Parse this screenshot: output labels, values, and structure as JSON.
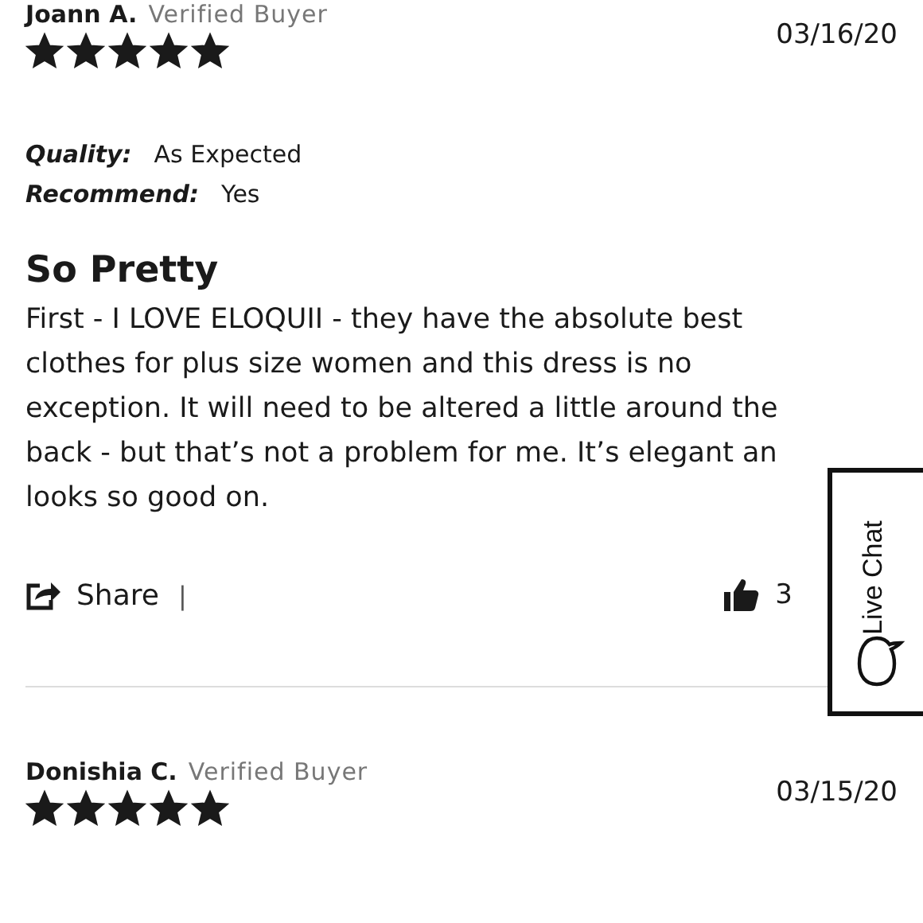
{
  "reviews": [
    {
      "name": "Joann A.",
      "badge": "Verified Buyer",
      "date": "03/16/20",
      "stars": 5,
      "attributes": [
        {
          "label": "Quality:",
          "value": "As Expected"
        },
        {
          "label": "Recommend:",
          "value": "Yes"
        }
      ],
      "title": "So Pretty",
      "body": "First - I LOVE ELOQUII - they have the absolute best\nclothes for plus size women and this dress is no\nexception. It will need to be altered a little around the\nback - but that’s not a problem for me. It’s elegant an\nlooks so good on.",
      "share": "Share",
      "separator": "|",
      "likes": "3"
    },
    {
      "name": "Donishia C.",
      "badge": "Verified Buyer",
      "date": "03/15/20",
      "stars": 5
    }
  ],
  "live_chat": {
    "label": "Live Chat"
  }
}
